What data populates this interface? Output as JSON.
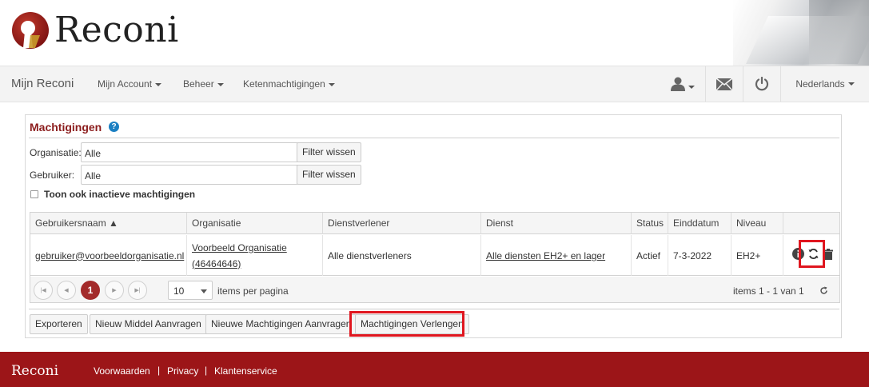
{
  "header": {
    "logo_text": "Reconi"
  },
  "navbar": {
    "brand": "Mijn Reconi",
    "items": [
      {
        "label": "Mijn Account"
      },
      {
        "label": "Beheer"
      },
      {
        "label": "Ketenmachtigingen"
      }
    ],
    "language": "Nederlands"
  },
  "panel": {
    "title": "Machtigingen",
    "help": "?",
    "filters": [
      {
        "label": "Organisatie:",
        "value": "Alle",
        "button": "Filter wissen"
      },
      {
        "label": "Gebruiker:",
        "value": "Alle",
        "button": "Filter wissen"
      }
    ],
    "inactive_label": "Toon ook inactieve machtigingen"
  },
  "grid": {
    "columns": [
      "Gebruikersnaam ▲",
      "Organisatie",
      "Dienstverlener",
      "Dienst",
      "Status",
      "Einddatum",
      "Niveau",
      ""
    ],
    "rows": [
      {
        "username": "gebruiker@voorbeeldorganisatie.nl",
        "organisation_line1": "Voorbeeld Organisatie",
        "organisation_line2": "(46464646)",
        "provider": "Alle dienstverleners",
        "service": "Alle diensten EH2+ en lager",
        "status": "Actief",
        "end_date": "7-3-2022",
        "level": "EH2+"
      }
    ],
    "pager": {
      "current_page": "1",
      "page_size": "10",
      "per_page_label": "items per pagina",
      "summary": "items 1 - 1 van 1"
    }
  },
  "actions": {
    "export": "Exporteren",
    "new_means": "Nieuw Middel Aanvragen",
    "new_authorizations": "Nieuwe Machtigingen Aanvragen",
    "extend_authorizations": "Machtigingen Verlengen"
  },
  "footer": {
    "brand": "Reconi",
    "links": [
      "Voorwaarden",
      "Privacy",
      "Klantenservice"
    ],
    "separator": "|"
  },
  "colors": {
    "brand_red": "#9c1518",
    "highlight": "#e0161f",
    "link_blue": "#1b7fc2"
  }
}
